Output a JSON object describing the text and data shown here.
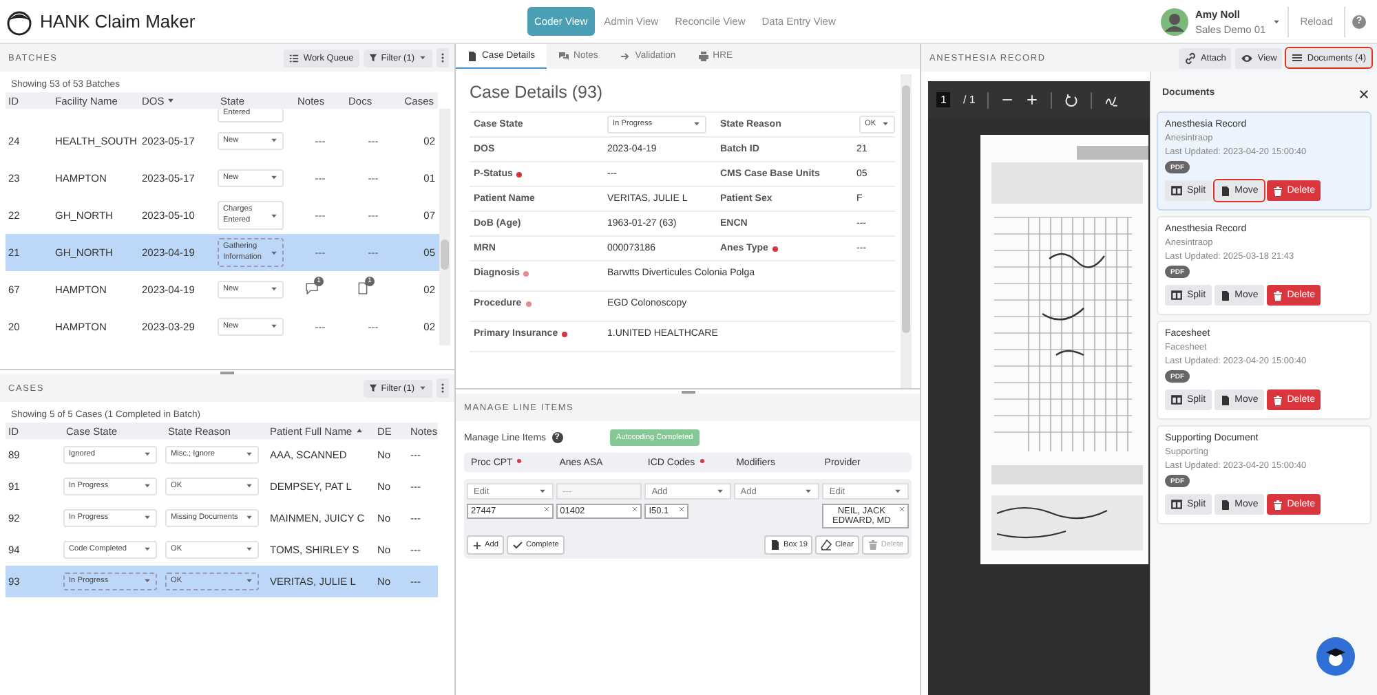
{
  "app": {
    "title": "HANK Claim Maker"
  },
  "nav": [
    {
      "label": "Coder View",
      "selected": true
    },
    {
      "label": "Admin View",
      "selected": false
    },
    {
      "label": "Reconcile View",
      "selected": false
    },
    {
      "label": "Data Entry View",
      "selected": false
    }
  ],
  "user": {
    "name": "Amy Noll",
    "org": "Sales Demo 01",
    "reload": "Reload",
    "help": "?"
  },
  "batches": {
    "title": "BATCHES",
    "work_queue": "Work Queue",
    "filter": "Filter (1)",
    "summary": "Showing 53 of 53 Batches",
    "columns": [
      {
        "label": "ID"
      },
      {
        "label": "Facility Name"
      },
      {
        "label": "DOS",
        "sorted": true,
        "descending": true
      },
      {
        "label": "State"
      },
      {
        "label": "Notes"
      },
      {
        "label": "Docs"
      },
      {
        "label": "Cases"
      }
    ],
    "rows": [
      {
        "kind": "partial",
        "state": "Entered"
      },
      {
        "kind": "row",
        "id": "24",
        "facility": "HEALTH_SOUTH",
        "dos": "2023-05-17",
        "state": "New",
        "notes": {
          "kind": "dash",
          "text": "---"
        },
        "docs": {
          "kind": "dash",
          "text": "---"
        },
        "cases": "02",
        "selected": false
      },
      {
        "kind": "row",
        "id": "23",
        "facility": "HAMPTON",
        "dos": "2023-05-17",
        "state": "New",
        "notes": {
          "kind": "dash",
          "text": "---"
        },
        "docs": {
          "kind": "dash",
          "text": "---"
        },
        "cases": "01",
        "selected": false
      },
      {
        "kind": "row",
        "id": "22",
        "facility": "GH_NORTH",
        "dos": "2023-05-10",
        "state": "Charges Entered",
        "notes": {
          "kind": "dash",
          "text": "---"
        },
        "docs": {
          "kind": "dash",
          "text": "---"
        },
        "cases": "07",
        "selected": false
      },
      {
        "kind": "row",
        "id": "21",
        "facility": "GH_NORTH",
        "dos": "2023-04-19",
        "state": "Gathering Information",
        "notes": {
          "kind": "dash",
          "text": "---"
        },
        "docs": {
          "kind": "dash",
          "text": "---"
        },
        "cases": "05",
        "selected": true
      },
      {
        "kind": "row",
        "id": "67",
        "facility": "HAMPTON",
        "dos": "2023-04-19",
        "state": "New",
        "notes": {
          "kind": "count",
          "count": "1"
        },
        "docs": {
          "kind": "count",
          "count": "1"
        },
        "cases": "02",
        "selected": false
      },
      {
        "kind": "row",
        "id": "20",
        "facility": "HAMPTON",
        "dos": "2023-03-29",
        "state": "New",
        "notes": {
          "kind": "dash",
          "text": "---"
        },
        "docs": {
          "kind": "dash",
          "text": "---"
        },
        "cases": "02",
        "selected": false
      }
    ]
  },
  "cases": {
    "title": "CASES",
    "filter": "Filter (1)",
    "summary": "Showing 5 of 5 Cases (1 Completed in Batch)",
    "columns": [
      {
        "label": "ID"
      },
      {
        "label": "Case State"
      },
      {
        "label": "State Reason"
      },
      {
        "label": "Patient Full Name",
        "sorted": true,
        "descending": false
      },
      {
        "label": "DE"
      },
      {
        "label": "Notes"
      }
    ],
    "rows": [
      {
        "id": "89",
        "state": "Ignored",
        "reason": "Misc.; Ignore",
        "patient": "AAA, SCANNED",
        "de": "No",
        "notes": "---",
        "selected": false
      },
      {
        "id": "91",
        "state": "In Progress",
        "reason": "OK",
        "patient": "DEMPSEY, PAT L",
        "de": "No",
        "notes": "---",
        "selected": false
      },
      {
        "id": "92",
        "state": "In Progress",
        "reason": "Missing Documents",
        "patient": "MAINMEN, JUICY C",
        "de": "No",
        "notes": "---",
        "selected": false
      },
      {
        "id": "94",
        "state": "Code Completed",
        "reason": "OK",
        "patient": "TOMS, SHIRLEY S",
        "de": "No",
        "notes": "---",
        "selected": false
      },
      {
        "id": "93",
        "state": "In Progress",
        "reason": "OK",
        "patient": "VERITAS, JULIE L",
        "de": "No",
        "notes": "---",
        "selected": true
      }
    ]
  },
  "detail_tabs": [
    {
      "label": "Case Details",
      "kind": "details",
      "selected": true
    },
    {
      "label": "Notes",
      "kind": "notes",
      "selected": false
    },
    {
      "label": "Validation",
      "kind": "validation",
      "selected": false
    },
    {
      "label": "HRE",
      "kind": "hre",
      "selected": false
    }
  ],
  "case_details": {
    "title": "Case Details (93)",
    "rows": [
      {
        "cells": [
          {
            "label": "Case State",
            "value": "In Progress",
            "kind": "select"
          },
          {
            "label": "State Reason",
            "value": "OK",
            "kind": "select"
          }
        ]
      },
      {
        "cells": [
          {
            "label": "DOS",
            "value": "2023-04-19",
            "kind": "text"
          },
          {
            "label": "Batch ID",
            "value": "21",
            "kind": "text"
          }
        ]
      },
      {
        "cells": [
          {
            "label": "P-Status",
            "value": "---",
            "kind": "text",
            "required": true,
            "color": "#d9363e"
          },
          {
            "label": "CMS Case Base Units",
            "value": "05",
            "kind": "text"
          }
        ]
      },
      {
        "cells": [
          {
            "label": "Patient Name",
            "value": "VERITAS, JULIE L",
            "kind": "text"
          },
          {
            "label": "Patient Sex",
            "value": "F",
            "kind": "text"
          }
        ]
      },
      {
        "cells": [
          {
            "label": "DoB (Age)",
            "value": "1963-01-27 (63)",
            "kind": "text"
          },
          {
            "label": "ENCN",
            "value": "---",
            "kind": "text"
          }
        ]
      },
      {
        "cells": [
          {
            "label": "MRN",
            "value": "000073186",
            "kind": "text"
          },
          {
            "label": "Anes Type",
            "value": "---",
            "kind": "text",
            "required": true,
            "color": "#d9363e"
          }
        ]
      },
      {
        "cells": [
          {
            "label": "Diagnosis",
            "value": "Barwtts Diverticules Colonia Polga",
            "kind": "text",
            "required": true,
            "color": "#e8898d"
          }
        ]
      },
      {
        "cells": [
          {
            "label": "Procedure",
            "value": "EGD Colonoscopy",
            "kind": "text",
            "required": true,
            "color": "#e8898d"
          }
        ]
      },
      {
        "cells": [
          {
            "label": "Primary Insurance",
            "value": "1.UNITED HEALTHCARE",
            "kind": "text",
            "required": true,
            "color": "#d9363e"
          }
        ]
      }
    ]
  },
  "line_items": {
    "title": "MANAGE LINE ITEMS",
    "label": "Manage Line Items",
    "help": "?",
    "status": "Autocoding Completed",
    "columns": [
      {
        "label": "Proc CPT",
        "required": true,
        "input": {
          "kind": "select",
          "text": "Edit"
        },
        "tag": "27447"
      },
      {
        "label": "Anes ASA",
        "input": {
          "kind": "disabled",
          "text": "---"
        },
        "tag": "01402"
      },
      {
        "label": "ICD Codes",
        "required": true,
        "input": {
          "kind": "select",
          "text": "Add"
        },
        "tag": "I50.1"
      },
      {
        "label": "Modifiers",
        "input": {
          "kind": "select",
          "text": "Add"
        }
      },
      {
        "label": "Provider",
        "input": {
          "kind": "select",
          "text": "Edit"
        },
        "tag": "NEIL, JACK EDWARD, MD"
      }
    ],
    "left_buttons": [
      {
        "label": "Add",
        "kind": "add"
      },
      {
        "label": "Complete",
        "kind": "complete"
      }
    ],
    "right_buttons": [
      {
        "label": "Box 19",
        "kind": "box19",
        "disabled": false
      },
      {
        "label": "Clear",
        "kind": "clear",
        "disabled": false
      },
      {
        "label": "Delete",
        "kind": "delete",
        "disabled": true
      }
    ]
  },
  "record": {
    "title": "ANESTHESIA RECORD",
    "buttons": [
      {
        "label": "Attach",
        "kind": "attach",
        "highlighted": false
      },
      {
        "label": "View",
        "kind": "view",
        "highlighted": false
      },
      {
        "label": "Documents (4)",
        "kind": "documents",
        "highlighted": true
      }
    ],
    "viewer": {
      "page": "1",
      "pages": "/ 1"
    }
  },
  "documents": {
    "title": "Documents",
    "items": [
      {
        "title": "Anesthesia Record",
        "type": "Anesintraop",
        "updated": "Last Updated: 2023-04-20 15:00:40",
        "format": "PDF",
        "selected": true,
        "actions": [
          {
            "label": "Split",
            "kind": "split",
            "highlighted": false
          },
          {
            "label": "Move",
            "kind": "move",
            "highlighted": true
          },
          {
            "label": "Delete",
            "kind": "delete",
            "highlighted": false
          }
        ]
      },
      {
        "title": "Anesthesia Record",
        "type": "Anesintraop",
        "updated": "Last Updated: 2025-03-18 21:43",
        "format": "PDF",
        "selected": false,
        "actions": [
          {
            "label": "Split",
            "kind": "split",
            "highlighted": false
          },
          {
            "label": "Move",
            "kind": "move",
            "highlighted": false
          },
          {
            "label": "Delete",
            "kind": "delete",
            "highlighted": false
          }
        ]
      },
      {
        "title": "Facesheet",
        "type": "Facesheet",
        "updated": "Last Updated: 2023-04-20 15:00:40",
        "format": "PDF",
        "selected": false,
        "actions": [
          {
            "label": "Split",
            "kind": "split",
            "highlighted": false
          },
          {
            "label": "Move",
            "kind": "move",
            "highlighted": false
          },
          {
            "label": "Delete",
            "kind": "delete",
            "highlighted": false
          }
        ]
      },
      {
        "title": "Supporting Document",
        "type": "Supporting",
        "updated": "Last Updated: 2023-04-20 15:00:40",
        "format": "PDF",
        "selected": false,
        "actions": [
          {
            "label": "Split",
            "kind": "split",
            "highlighted": false
          },
          {
            "label": "Move",
            "kind": "move",
            "highlighted": false
          },
          {
            "label": "Delete",
            "kind": "delete",
            "highlighted": false
          }
        ]
      }
    ]
  }
}
